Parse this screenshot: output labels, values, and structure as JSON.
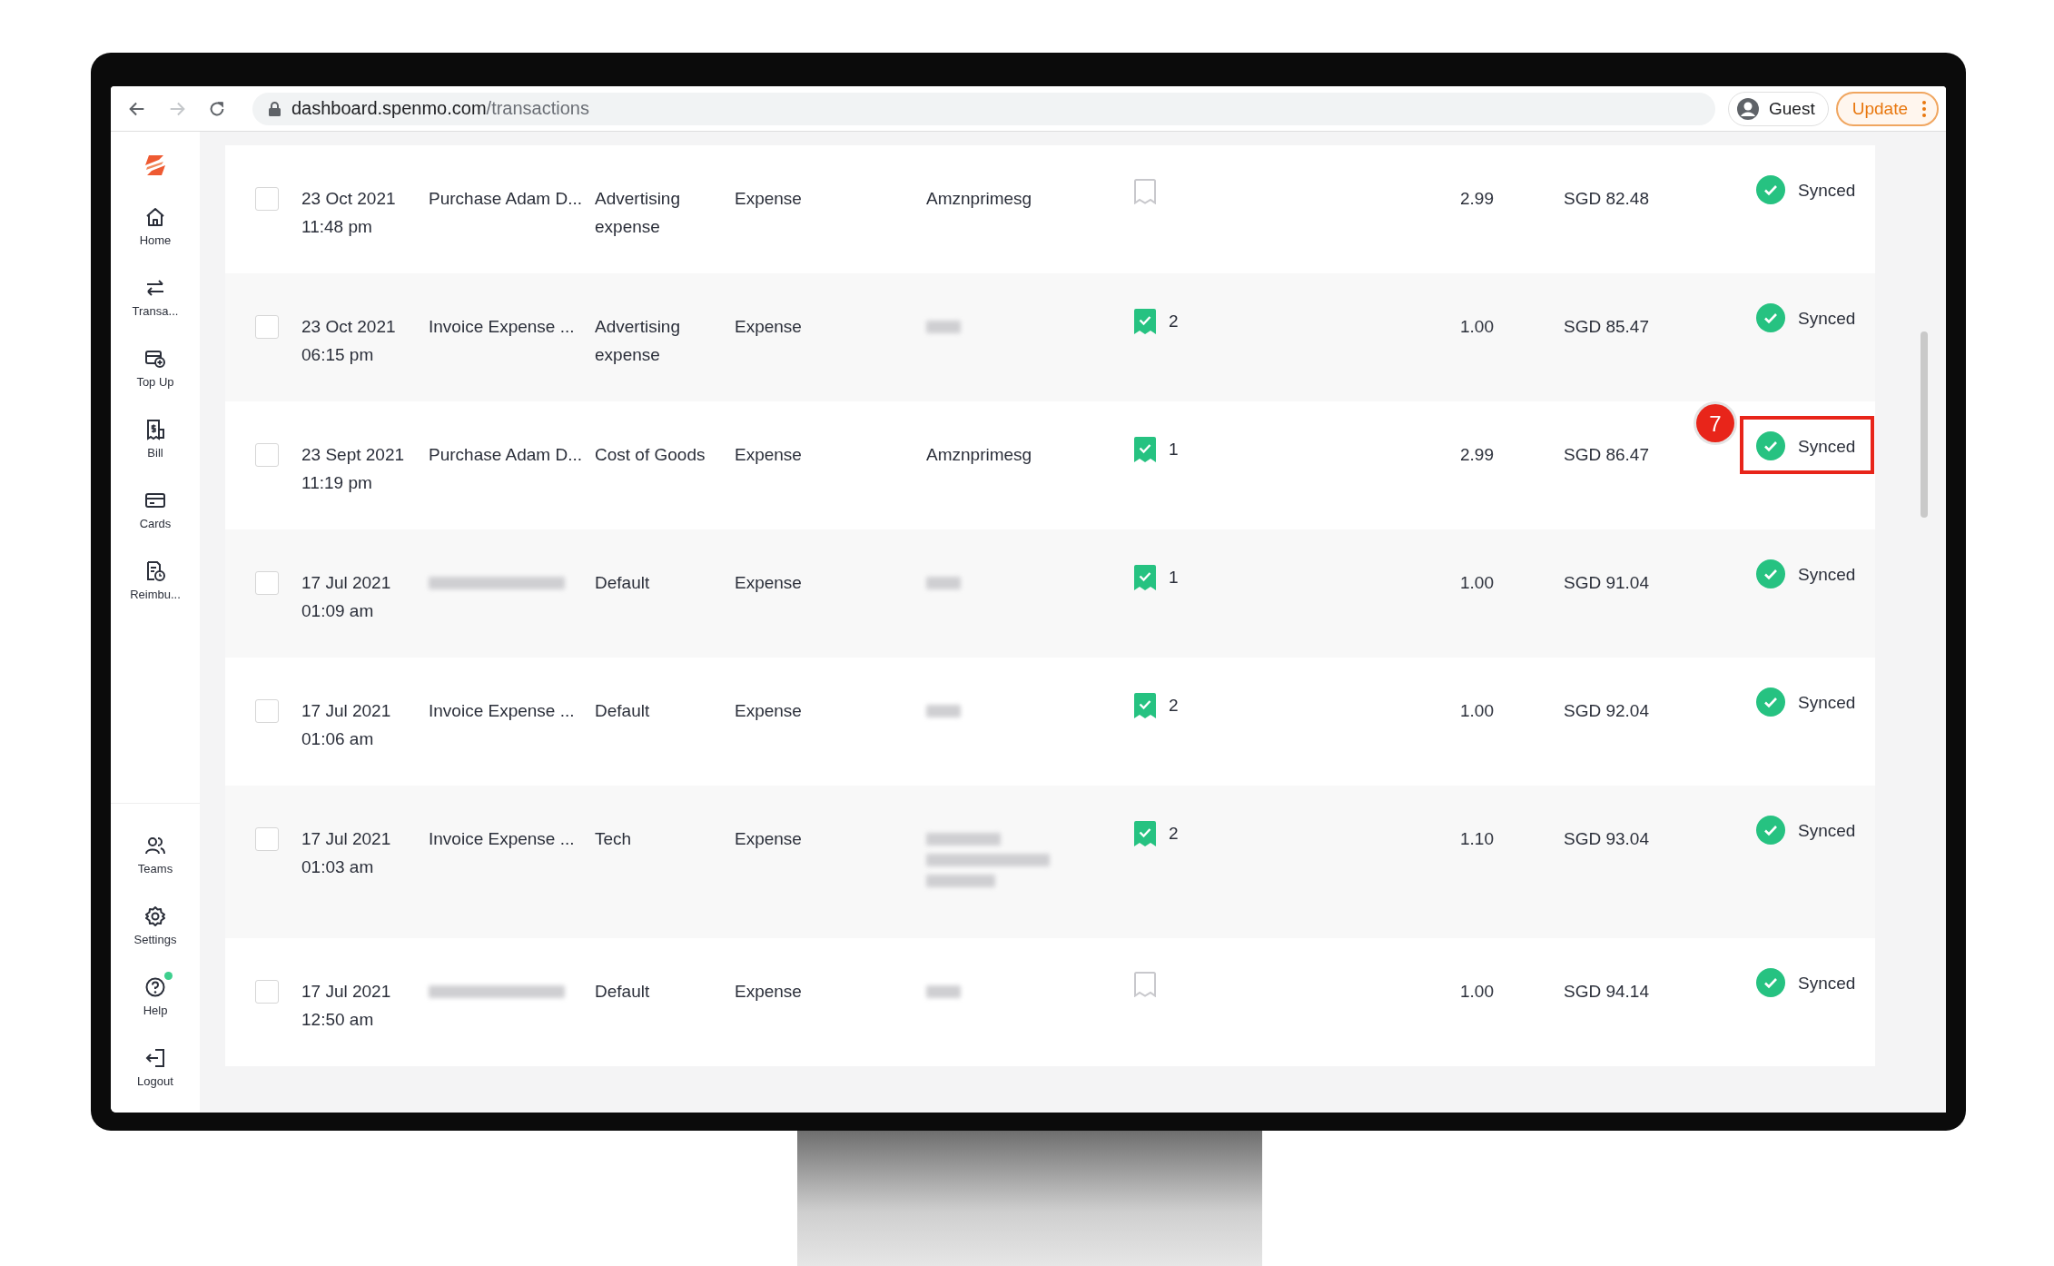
{
  "browser": {
    "forward_disabled": true,
    "url_host": "dashboard.spenmo.com",
    "url_path": "/transactions",
    "profile": "Guest",
    "update_button": "Update"
  },
  "sidebar": {
    "items": [
      {
        "kind": "home",
        "label": "Home"
      },
      {
        "kind": "transfer",
        "label": "Transa..."
      },
      {
        "kind": "topup",
        "label": "Top Up"
      },
      {
        "kind": "bill",
        "label": "Bill"
      },
      {
        "kind": "card",
        "label": "Cards"
      },
      {
        "kind": "reimburse",
        "label": "Reimbu..."
      }
    ],
    "bottom_items": [
      {
        "kind": "teams",
        "label": "Teams",
        "notification": false
      },
      {
        "kind": "settings",
        "label": "Settings",
        "notification": false
      },
      {
        "kind": "help",
        "label": "Help",
        "notification": true
      },
      {
        "kind": "logout",
        "label": "Logout",
        "notification": false
      }
    ]
  },
  "transactions": [
    {
      "checked": false,
      "date": "23 Oct 2021",
      "time": "11:48 pm",
      "description": "Purchase Adam D...",
      "description_redacted": false,
      "category": "Advertising expense",
      "type": "Expense",
      "merchant": {
        "kind": "text",
        "text": "Amznprimesg"
      },
      "receipt": {
        "attached": false
      },
      "amount": "2.99",
      "total": "SGD 82.48",
      "status": "Synced",
      "highlighted": false
    },
    {
      "checked": false,
      "date": "23 Oct 2021",
      "time": "06:15 pm",
      "description": "Invoice Expense ...",
      "description_redacted": false,
      "category": "Advertising expense",
      "type": "Expense",
      "merchant": {
        "kind": "redacted"
      },
      "receipt": {
        "attached": true,
        "count": "2"
      },
      "amount": "1.00",
      "total": "SGD 85.47",
      "status": "Synced",
      "highlighted": false
    },
    {
      "checked": false,
      "date": "23 Sept 2021",
      "time": "11:19 pm",
      "description": "Purchase Adam D...",
      "description_redacted": false,
      "category": "Cost of Goods",
      "type": "Expense",
      "merchant": {
        "kind": "text",
        "text": "Amznprimesg"
      },
      "receipt": {
        "attached": true,
        "count": "1"
      },
      "amount": "2.99",
      "total": "SGD 86.47",
      "status": "Synced",
      "highlighted": true,
      "callout": "7"
    },
    {
      "checked": false,
      "date": "17 Jul 2021",
      "time": "01:09 am",
      "description_redacted": true,
      "category": "Default",
      "type": "Expense",
      "merchant": {
        "kind": "redacted"
      },
      "receipt": {
        "attached": true,
        "count": "1"
      },
      "amount": "1.00",
      "total": "SGD 91.04",
      "status": "Synced",
      "highlighted": false
    },
    {
      "checked": false,
      "date": "17 Jul 2021",
      "time": "01:06 am",
      "description": "Invoice Expense ...",
      "description_redacted": false,
      "category": "Default",
      "type": "Expense",
      "merchant": {
        "kind": "redacted"
      },
      "receipt": {
        "attached": true,
        "count": "2"
      },
      "amount": "1.00",
      "total": "SGD 92.04",
      "status": "Synced",
      "highlighted": false
    },
    {
      "checked": false,
      "date": "17 Jul 2021",
      "time": "01:03 am",
      "description": "Invoice Expense ...",
      "description_redacted": false,
      "category": "Tech",
      "type": "Expense",
      "merchant": {
        "kind": "redacted-long"
      },
      "receipt": {
        "attached": true,
        "count": "2"
      },
      "amount": "1.10",
      "total": "SGD 93.04",
      "status": "Synced",
      "highlighted": false
    },
    {
      "checked": false,
      "date": "17 Jul 2021",
      "time": "12:50 am",
      "description_redacted": true,
      "category": "Default",
      "type": "Expense",
      "merchant": {
        "kind": "redacted"
      },
      "receipt": {
        "attached": false
      },
      "amount": "1.00",
      "total": "SGD 94.14",
      "status": "Synced",
      "highlighted": false
    }
  ]
}
